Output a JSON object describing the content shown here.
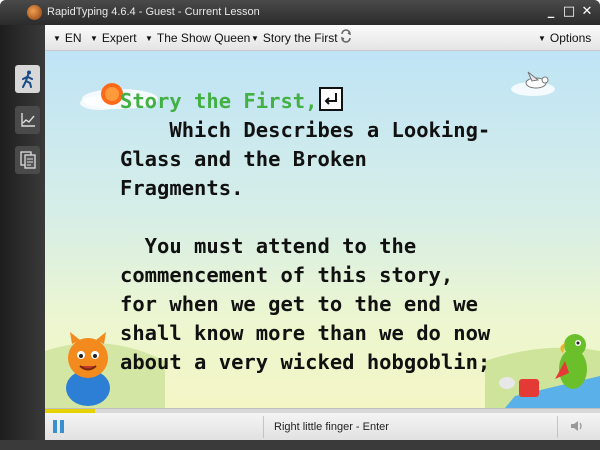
{
  "window": {
    "title": "RapidTyping 4.6.4 - Guest - Current Lesson",
    "controls": {
      "minimize": "_",
      "maximize": "□",
      "close": "✕"
    }
  },
  "sidebar": {
    "items": [
      {
        "name": "lesson",
        "icon": "running-man-icon",
        "active": true
      },
      {
        "name": "statistics",
        "icon": "chart-icon",
        "active": false
      },
      {
        "name": "editor",
        "icon": "documents-icon",
        "active": false
      }
    ]
  },
  "toolbar": {
    "language": "EN",
    "level": "Expert",
    "course": "The Show Queen",
    "lesson": "Story the First",
    "options": "Options"
  },
  "lesson": {
    "typed_text": "Story the First,",
    "lines": [
      "    Which Describes a Looking-",
      "Glass and the Broken",
      "Fragments.",
      "",
      "  You must attend to the",
      "commencement of this story,",
      "for when we get to the end we",
      "shall know more than we do now",
      "about a very wicked hobgoblin;"
    ],
    "line1_prefix": "    "
  },
  "status": {
    "progress_fraction": 0.09,
    "hint": "Right little finger - Enter"
  },
  "colors": {
    "typed": "#43b043",
    "progress": "#e6d200",
    "accent": "#3a8fd0"
  }
}
